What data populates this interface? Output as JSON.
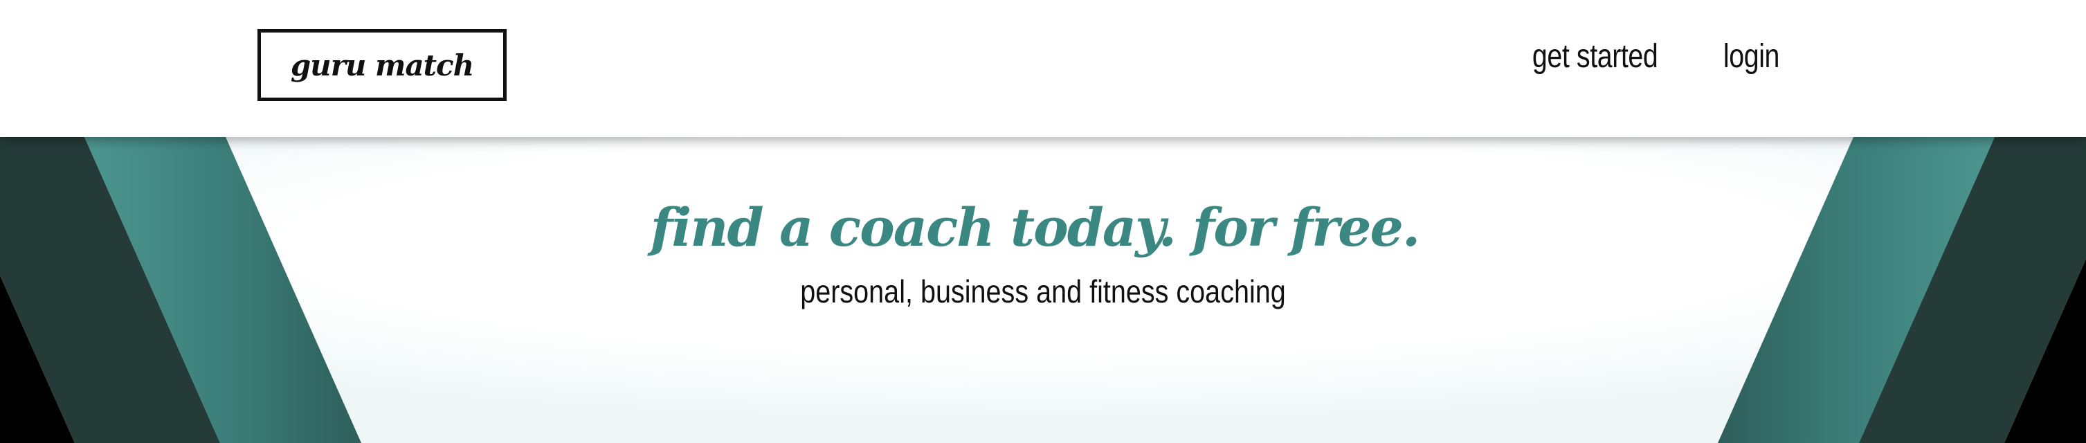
{
  "header": {
    "logo_text": "guru match",
    "nav": [
      {
        "label": "get started"
      },
      {
        "label": "login"
      }
    ]
  },
  "hero": {
    "title": "find a coach today. for free.",
    "subtitle": "personal, business and fitness coaching"
  },
  "colors": {
    "accent_teal": "#3b8782",
    "dark_teal": "#243b38",
    "black": "#000000",
    "text": "#111111"
  }
}
